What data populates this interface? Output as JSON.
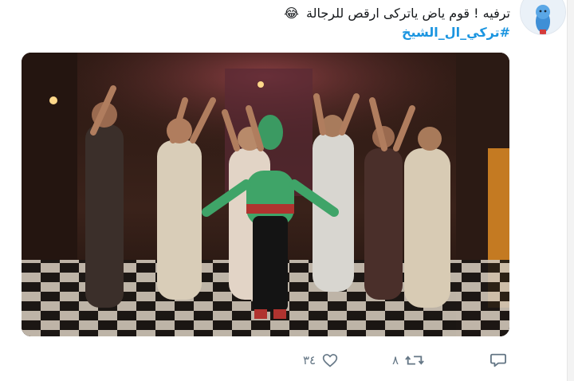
{
  "tweet": {
    "text": "ترفيه ! قوم ياض ياتركى ارقص للرجالة",
    "emoji": "😂",
    "hashtag": "#تركي_ال_الشيخ"
  },
  "media": {
    "alt_icon": "video-still-image"
  },
  "actions": {
    "like_count": "٣٤",
    "retweet_count": "٨",
    "reply_icon": "reply-icon",
    "retweet_icon": "retweet-icon",
    "like_icon": "heart-icon"
  },
  "colors": {
    "text": "#14171a",
    "hashtag": "#1b95e0",
    "icon": "#657786"
  }
}
